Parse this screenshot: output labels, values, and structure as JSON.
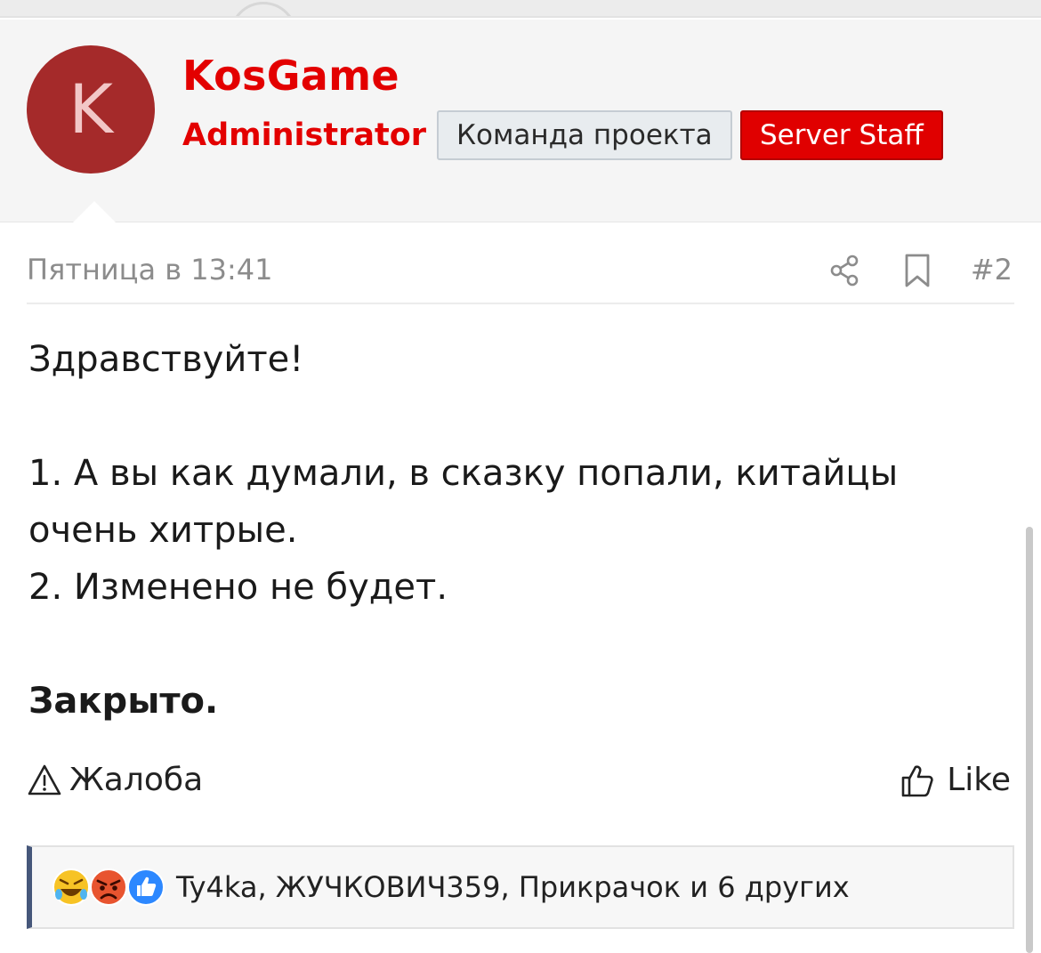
{
  "post": {
    "author": {
      "avatar_letter": "K",
      "username": "KosGame",
      "title": "Administrator",
      "banners": [
        "Команда проекта",
        "Server Staff"
      ]
    },
    "date": "Пятница в 13:41",
    "number": "#2",
    "body_lines": [
      "Здравствуйте!",
      "",
      "1. А вы как думали, в сказку попали, китайцы",
      "очень хитрые.",
      "2. Изменено не будет.",
      "",
      "Закрыто."
    ],
    "actions": {
      "report_label": "Жалоба",
      "like_label": "Like"
    },
    "reactions": {
      "icons": [
        "rofl-reaction-icon",
        "angry-reaction-icon",
        "like-reaction-icon"
      ],
      "text": "Ty4ka, ЖУЧКОВИЧ359, Прикрачок и 6 других"
    }
  },
  "colors": {
    "accent_red": "#e30000",
    "avatar_bg": "#a52a2a",
    "reaction_border": "#46577a"
  }
}
